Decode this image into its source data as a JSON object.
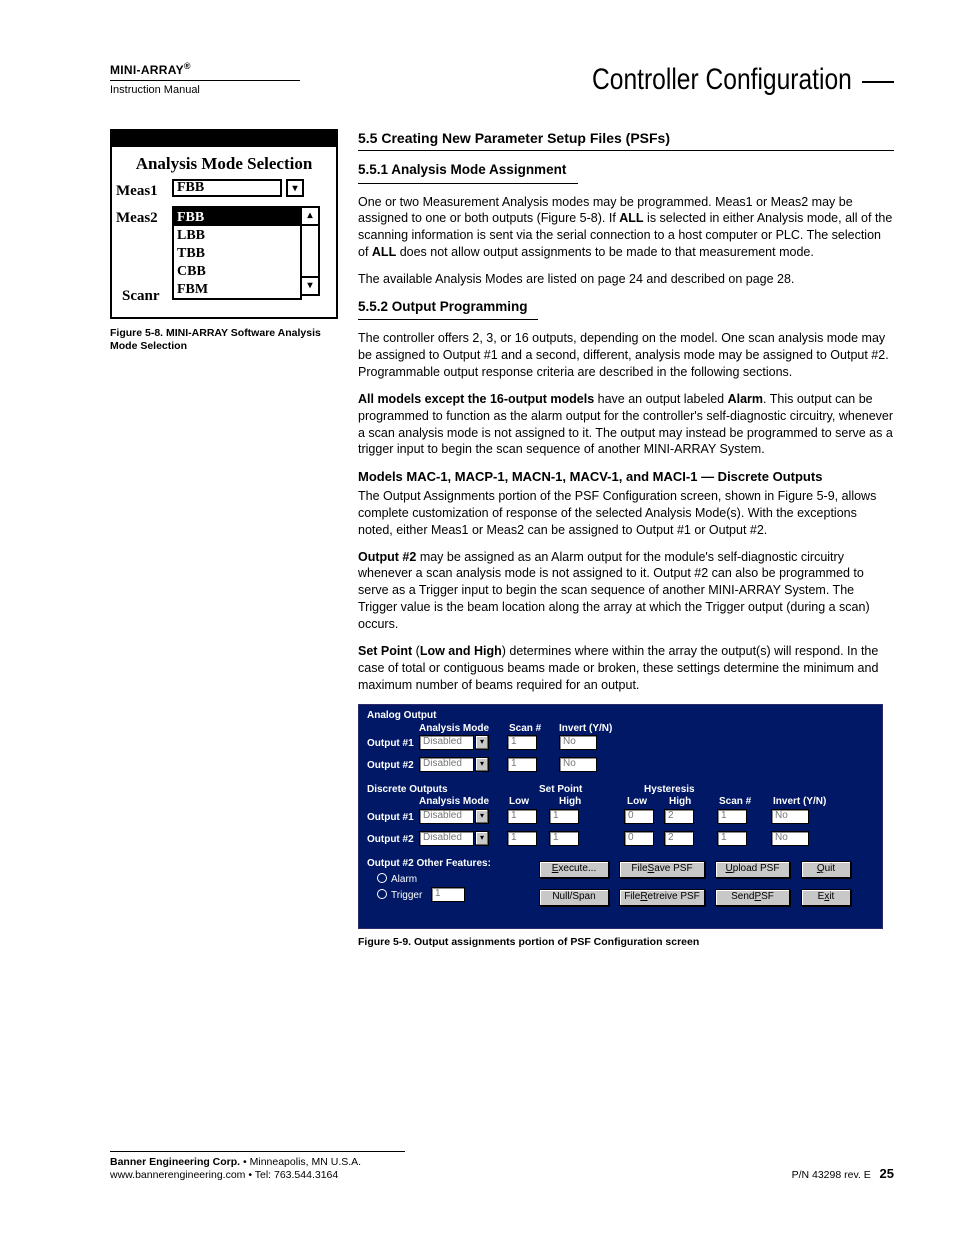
{
  "header": {
    "product": "MINI-ARRAY",
    "reg": "®",
    "sub": "Instruction Manual",
    "title": "Controller Configuration"
  },
  "fig8": {
    "title": "Analysis Mode Selection",
    "meas1_lbl": "Meas1",
    "meas1_val": "FBB",
    "meas2_lbl": "Meas2",
    "scanr_lbl": "Scanr",
    "list": [
      "FBB",
      "LBB",
      "TBB",
      "CBB",
      "FBM"
    ],
    "caption": "Figure 5-8.  MINI-ARRAY Software Analysis Mode Selection"
  },
  "s55": {
    "h": "5.5  Creating New Parameter Setup Files (PSFs)",
    "s551_h": "5.5.1  Analysis Mode Assignment",
    "s551_p1a": "One or two Measurement Analysis modes may be programmed. Meas1 or Meas2 may be assigned to one or both outputs (Figure 5-8). If ",
    "s551_p1b": "ALL",
    "s551_p1c": " is selected in either Analysis mode, all of the scanning information is sent via the serial connection to a host computer or PLC. The selection of ",
    "s551_p1d": "ALL",
    "s551_p1e": " does not allow output assignments to be made to that measurement mode.",
    "s551_p2": "The available Analysis Modes are listed on page 24 and described on page 28.",
    "s552_h": "5.5.2  Output Programming",
    "s552_p1": "The controller offers 2, 3, or 16 outputs, depending on the model. One scan analysis mode may be assigned to Output #1 and a second, different, analysis mode may be assigned to Output #2. Programmable output response criteria are described in the following sections.",
    "s552_p2a": "All models except the 16-output models",
    "s552_p2b": " have an output labeled ",
    "s552_p2c": "Alarm",
    "s552_p2d": ". This output can be programmed to function as the alarm output for the controller's self-diagnostic circuitry, whenever a scan analysis mode is not assigned to it. The output may instead be programmed to serve as a trigger input to begin the scan sequence of another MINI-ARRAY System.",
    "s552_h3": "Models MAC-1, MACP-1, MACN-1, MACV-1, and MACI-1 — Discrete Outputs",
    "s552_p3": "The Output Assignments portion of the PSF Configuration screen, shown in Figure 5-9, allows complete customization of response of the selected Analysis Mode(s). With the exceptions noted, either Meas1 or Meas2 can be assigned to Output #1 or Output #2.",
    "s552_p4a": "Output #2",
    "s552_p4b": " may be assigned as an Alarm output for the module's self-diagnostic circuitry whenever a scan analysis mode is not assigned to it. Output #2 can also be programmed to serve as a Trigger input to begin the scan sequence of another MINI-ARRAY System. The Trigger value is the beam location along the array at which the Trigger output (during a scan) occurs.",
    "s552_p5a": "Set Point",
    "s552_p5b": " (",
    "s552_p5c": "Low and High",
    "s552_p5d": ") determines where within the array the output(s) will respond. In the case of total or contiguous beams made or broken, these settings determine the minimum and maximum number of beams required for an output."
  },
  "fig9": {
    "win_title": "Analog Output",
    "col_am": "Analysis Mode",
    "col_sn": "Scan #",
    "col_inv": "Invert (Y/N)",
    "out1": "Output #1",
    "out2": "Output #2",
    "disabled": "Disabled",
    "no": "No",
    "sec2": "Discrete Outputs",
    "sp": "Set Point",
    "low": "Low",
    "high": "High",
    "hy": "Hysteresis",
    "other": "Output #2 Other Features:",
    "alarm": "Alarm",
    "trigger": "Trigger",
    "trigval": "1",
    "btn_exec": "Execute...",
    "btn_fsave": "File Save PSF",
    "btn_upload": "Upload PSF",
    "btn_quit": "Quit",
    "btn_null": "Null/Span",
    "btn_fret": "File Retreive PSF",
    "btn_send": "Send PSF",
    "btn_exit": "Exit",
    "v1": "1",
    "v0": "0",
    "v2": "2",
    "caption": "Figure 5-9.  Output assignments portion of PSF Configuration screen"
  },
  "footer": {
    "l1a": "Banner Engineering Corp.",
    "l1b": " • Minneapolis, MN U.S.A.",
    "l2": "www.bannerengineering.com  •  Tel: 763.544.3164",
    "pn": "P/N 43298 rev. E",
    "page": "25"
  }
}
